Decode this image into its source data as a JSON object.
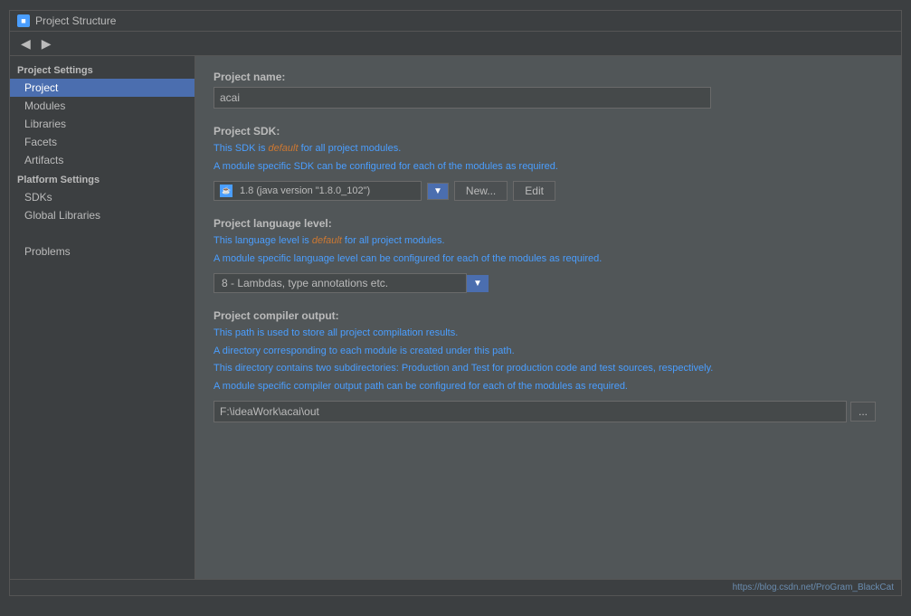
{
  "window": {
    "title": "Project Structure",
    "icon": "■"
  },
  "toolbar": {
    "back_label": "◀",
    "forward_label": "▶"
  },
  "sidebar": {
    "project_settings_header": "Project Settings",
    "items_project_settings": [
      {
        "id": "project",
        "label": "Project",
        "active": true
      },
      {
        "id": "modules",
        "label": "Modules",
        "active": false
      },
      {
        "id": "libraries",
        "label": "Libraries",
        "active": false
      },
      {
        "id": "facets",
        "label": "Facets",
        "active": false
      },
      {
        "id": "artifacts",
        "label": "Artifacts",
        "active": false
      }
    ],
    "platform_settings_header": "Platform Settings",
    "items_platform_settings": [
      {
        "id": "sdks",
        "label": "SDKs",
        "active": false
      },
      {
        "id": "global_libraries",
        "label": "Global Libraries",
        "active": false
      }
    ],
    "problems_label": "Problems"
  },
  "main": {
    "project_name": {
      "label": "Project name:",
      "value": "acai"
    },
    "project_sdk": {
      "label": "Project SDK:",
      "description_line1": "This SDK is default for all project modules.",
      "description_line2": "A module specific SDK can be configured for each of the modules as required.",
      "sdk_value": "1.8 (java version \"1.8.0_102\")",
      "sdk_icon": "☕",
      "new_label": "New...",
      "edit_label": "Edit"
    },
    "project_language_level": {
      "label": "Project language level:",
      "description_line1": "This language level is default for all project modules.",
      "description_line2": "A module specific language level can be configured for each of the modules as required.",
      "value": "8 - Lambdas, type annotations etc."
    },
    "project_compiler_output": {
      "label": "Project compiler output:",
      "description_line1": "This path is used to store all project compilation results.",
      "description_line2": "A directory corresponding to each module is created under this path.",
      "description_line3": "This directory contains two subdirectories: Production and Test for production code and test sources, respectively.",
      "description_line4": "A module specific compiler output path can be configured for each of the modules as required.",
      "value": "F:\\ideaWork\\acai\\out",
      "browse_label": "..."
    }
  },
  "bottom_bar": {
    "url": "https://blog.csdn.net/ProGram_BlackCat"
  }
}
